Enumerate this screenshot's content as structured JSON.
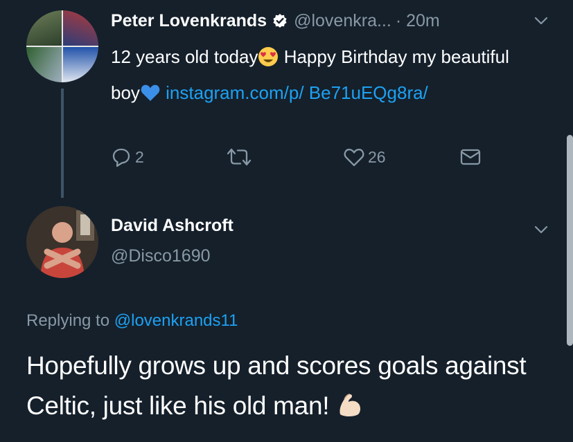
{
  "tweet": {
    "author_name": "Peter Lovenkrands",
    "handle": "@lovenkra...",
    "time": "· 20m",
    "text_part1": "12 years old today",
    "text_part2": " Happy Birthday my beautiful boy",
    "link": " instagram.com/p/ Be71uEQg8ra/",
    "emoji1": "heart-eyes-emoji",
    "emoji2": "blue-heart-emoji",
    "reply_count": "2",
    "retweet_count": "",
    "like_count": "26"
  },
  "reply": {
    "author_name": "David Ashcroft",
    "handle": "@Disco1690",
    "replying_prefix": "Replying to ",
    "replying_to": "@lovenkrands11",
    "text": "Hopefully grows up and scores goals against Celtic, just like his old man! ",
    "emoji": "flexed-biceps-emoji"
  },
  "colors": {
    "background": "#15202b",
    "text": "#ffffff",
    "muted": "#8899a6",
    "link": "#1da1f2"
  }
}
